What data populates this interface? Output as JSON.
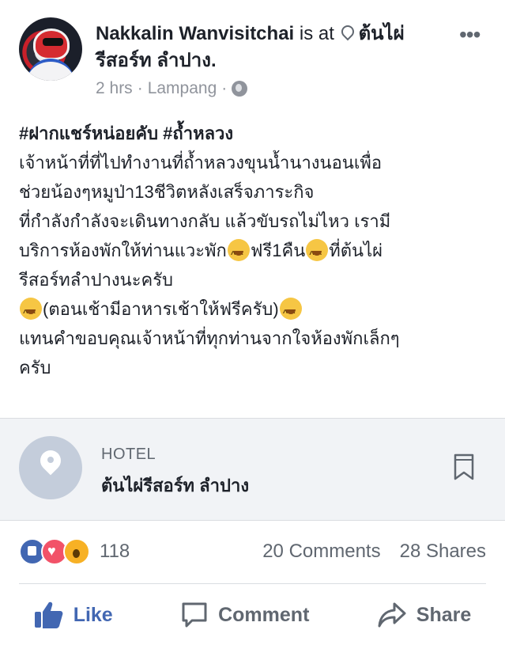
{
  "header": {
    "author": "Nakkalin Wanvisitchai",
    "is_at": "is at",
    "place": "ต้นไผ่รีสอร์ท ลำปาง.",
    "time": "2 hrs",
    "location": "Lampang",
    "dot": "·",
    "more": "•••"
  },
  "post": {
    "tags": "#ฝากแชร์หน่อยคับ #ถ้ำหลวง",
    "line1": "เจ้าหน้าที่ที่ไปทำงานที่ถ้ำหลวงขุนน้ำนางนอนเพื่อ",
    "line2": "ช่วยน้องๆหมูป่า13ชีวิตหลังเสร็จภาระกิจ",
    "line3": "ที่กำลังกำลังจะเดินทางกลับ แล้วขับรถไม่ไหว เรามี",
    "line4a": "บริการห้องพักให้ท่านแวะพัก",
    "line4b": "ฟรี1คืน",
    "line4c": "ที่ต้นไผ่",
    "line5": "รีสอร์ทลำปางนะครับ",
    "line6": "(ตอนเช้ามีอาหารเช้าให้ฟรีครับ)",
    "line7": "แทนคำขอบคุณเจ้าหน้าที่ทุกท่านจากใจห้องพักเล็กๆ",
    "line8": "ครับ"
  },
  "card": {
    "category": "HOTEL",
    "title": "ต้นไผ่รีสอร์ท ลำปาง"
  },
  "stats": {
    "reaction_count": "118",
    "comments": "20 Comments",
    "shares": "28 Shares"
  },
  "actions": {
    "like": "Like",
    "comment": "Comment",
    "share": "Share"
  },
  "colors": {
    "brand_blue": "#4267b2",
    "text": "#1d2129",
    "muted": "#606770"
  }
}
